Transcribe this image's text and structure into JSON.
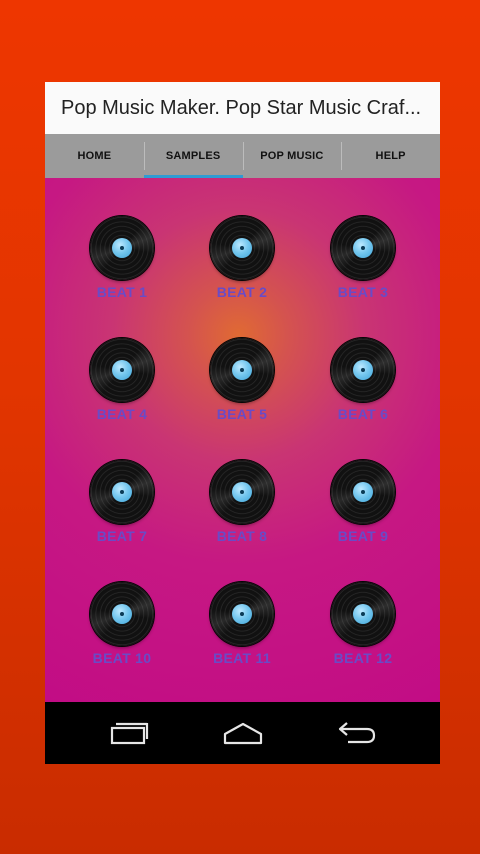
{
  "app": {
    "title": "Pop Music Maker. Pop Star Music Craf..."
  },
  "tabs": [
    {
      "label": "HOME",
      "active": false
    },
    {
      "label": "SAMPLES",
      "active": true
    },
    {
      "label": "POP MUSIC",
      "active": false
    },
    {
      "label": "HELP",
      "active": false
    }
  ],
  "beats": [
    {
      "label": "BEAT 1"
    },
    {
      "label": "BEAT 2"
    },
    {
      "label": "BEAT 3"
    },
    {
      "label": "BEAT 4"
    },
    {
      "label": "BEAT 5"
    },
    {
      "label": "BEAT 6"
    },
    {
      "label": "BEAT 7"
    },
    {
      "label": "BEAT 8"
    },
    {
      "label": "BEAT 9"
    },
    {
      "label": "BEAT 10"
    },
    {
      "label": "BEAT 11"
    },
    {
      "label": "BEAT 12"
    }
  ],
  "colors": {
    "background": "#e23500",
    "content": "#c61883",
    "tab_bar": "#9b9b9b",
    "tab_indicator": "#2f9bd3",
    "beat_label": "#6a4bc6",
    "record_label": "#76c8ef"
  },
  "icons": {
    "beat": "vinyl-record-icon",
    "nav": [
      "recent-apps-icon",
      "home-icon",
      "back-icon"
    ]
  }
}
